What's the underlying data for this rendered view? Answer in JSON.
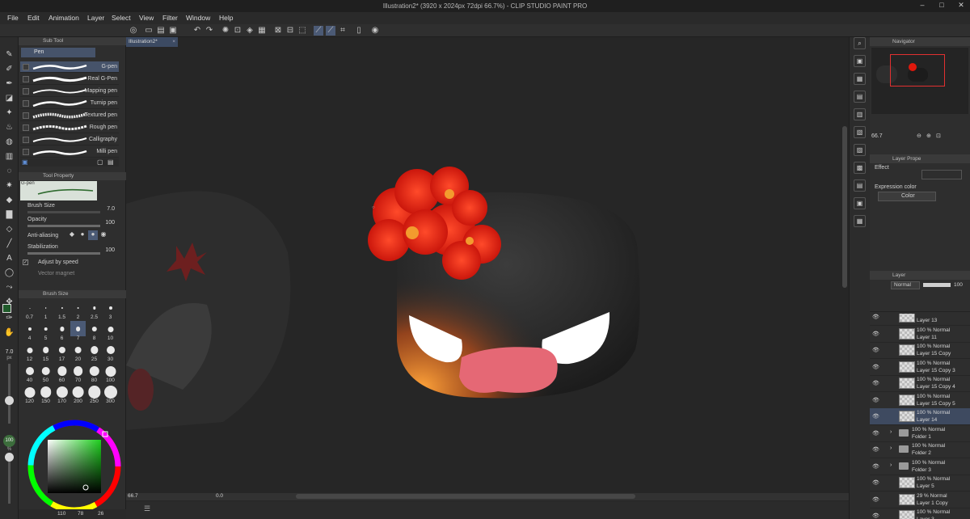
{
  "window": {
    "title": "Illustration2* (3920 x 2024px 72dpi 66.7%) - CLIP STUDIO PAINT PRO",
    "controls": [
      "–",
      "□",
      "✕"
    ]
  },
  "menu": [
    "File",
    "Edit",
    "Animation",
    "Layer",
    "Select",
    "View",
    "Filter",
    "Window",
    "Help"
  ],
  "sub_tool": {
    "panel_title": "Sub Tool",
    "group_tab": "Pen",
    "brushes": [
      "G-pen",
      "Real G-Pen",
      "Mapping pen",
      "Turnip pen",
      "Textured pen",
      "Rough pen",
      "Calligraphy",
      "Milli pen"
    ],
    "selected_brush": "G-pen"
  },
  "tool_property": {
    "panel_title": "Tool Property",
    "tool_name": "G-pen",
    "brush_size_label": "Brush Size",
    "brush_size_value": "7.0",
    "opacity_label": "Opacity",
    "opacity_value": "100",
    "anti_aliasing_label": "Anti-aliasing",
    "stabilization_label": "Stabilization",
    "stabilization_value": "100",
    "adjust_label": "Adjust by speed",
    "vector_magnet_label": "Vector magnet"
  },
  "brush_size_panel": {
    "panel_title": "Brush Size",
    "sizes": [
      "0.7",
      "1",
      "1.5",
      "2",
      "2.5",
      "3",
      "4",
      "5",
      "6",
      "7",
      "8",
      "10",
      "12",
      "15",
      "17",
      "20",
      "25",
      "30",
      "40",
      "50",
      "60",
      "70",
      "80",
      "100",
      "120",
      "150",
      "170",
      "200",
      "250",
      "300"
    ],
    "selected": "7"
  },
  "tool_column": {
    "size_readout": "7.0",
    "size_unit": "px",
    "opacity_readout": "100",
    "opacity_unit": "%"
  },
  "color": {
    "main": "#1f5a2a",
    "sub": "#ffffff",
    "hsv_readout": [
      "110",
      "78",
      "26"
    ]
  },
  "canvas": {
    "doc_tab": "Illustration2*",
    "zoom_readout": "66.7",
    "angle_readout": "0.0"
  },
  "navigator": {
    "panel_title": "Navigator",
    "zoom_value": "66.7"
  },
  "layer_property": {
    "panel_title": "Layer Prope",
    "effect_label": "Effect",
    "expression_label": "Expression color",
    "expression_value": "Color"
  },
  "layer_panel": {
    "panel_title": "Layer",
    "blend_mode": "Normal",
    "opacity": "100",
    "layers": [
      {
        "line1": "",
        "line2": "Layer 13",
        "type": "layer"
      },
      {
        "line1": "100 % Normal",
        "line2": "Layer 11",
        "type": "layer"
      },
      {
        "line1": "100 % Normal",
        "line2": "Layer 15 Copy",
        "type": "layer"
      },
      {
        "line1": "100 % Normal",
        "line2": "Layer 15 Copy 3",
        "type": "layer"
      },
      {
        "line1": "100 % Normal",
        "line2": "Layer 15 Copy 4",
        "type": "layer"
      },
      {
        "line1": "100 % Normal",
        "line2": "Layer 15 Copy 5",
        "type": "layer"
      },
      {
        "line1": "100 % Normal",
        "line2": "Layer 14",
        "type": "layer",
        "selected": true
      },
      {
        "line1": "100 % Normal",
        "line2": "Folder 1",
        "type": "folder"
      },
      {
        "line1": "100 % Normal",
        "line2": "Folder 2",
        "type": "folder"
      },
      {
        "line1": "100 % Normal",
        "line2": "Folder 3",
        "type": "folder"
      },
      {
        "line1": "100 % Normal",
        "line2": "Layer 5",
        "type": "layer"
      },
      {
        "line1": "29 % Normal",
        "line2": "Layer 1 Copy",
        "type": "layer"
      },
      {
        "line1": "100 % Normal",
        "line2": "Layer 3",
        "type": "layer"
      }
    ]
  }
}
